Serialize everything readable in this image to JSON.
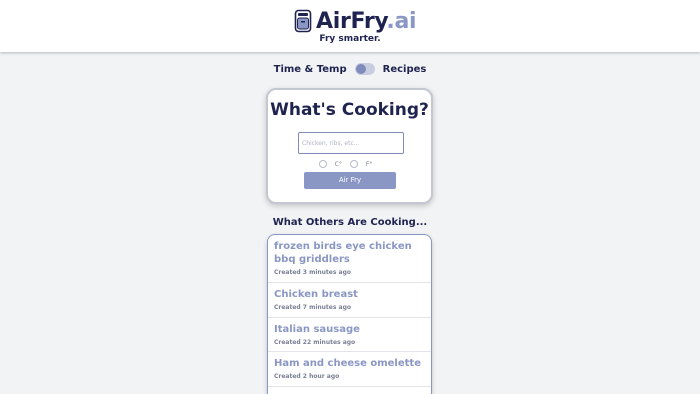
{
  "brand": {
    "name_main": "AirFry",
    "name_suffix": ".ai",
    "tagline": "Fry smarter."
  },
  "mode_toggle": {
    "left_label": "Time & Temp",
    "right_label": "Recipes"
  },
  "card": {
    "title": "What's Cooking?",
    "input_placeholder": "Chicken, ribs, etc...",
    "input_value": "",
    "unit_c": "C°",
    "unit_f": "F°",
    "button_label": "Air Fry"
  },
  "others": {
    "title": "What Others Are Cooking...",
    "items": [
      {
        "name": "frozen birds eye chicken bbq griddlers",
        "time": "Created 3 minutes ago"
      },
      {
        "name": "Chicken breast",
        "time": "Created 7 minutes ago"
      },
      {
        "name": "Italian sausage",
        "time": "Created 22 minutes ago"
      },
      {
        "name": "Ham and cheese omelette",
        "time": "Created 2 hour ago"
      }
    ]
  },
  "colors": {
    "navy": "#1e2350",
    "accent": "#8a97c4",
    "background": "#f2f3f5"
  },
  "icons": {
    "logo": "air-fryer-icon"
  }
}
